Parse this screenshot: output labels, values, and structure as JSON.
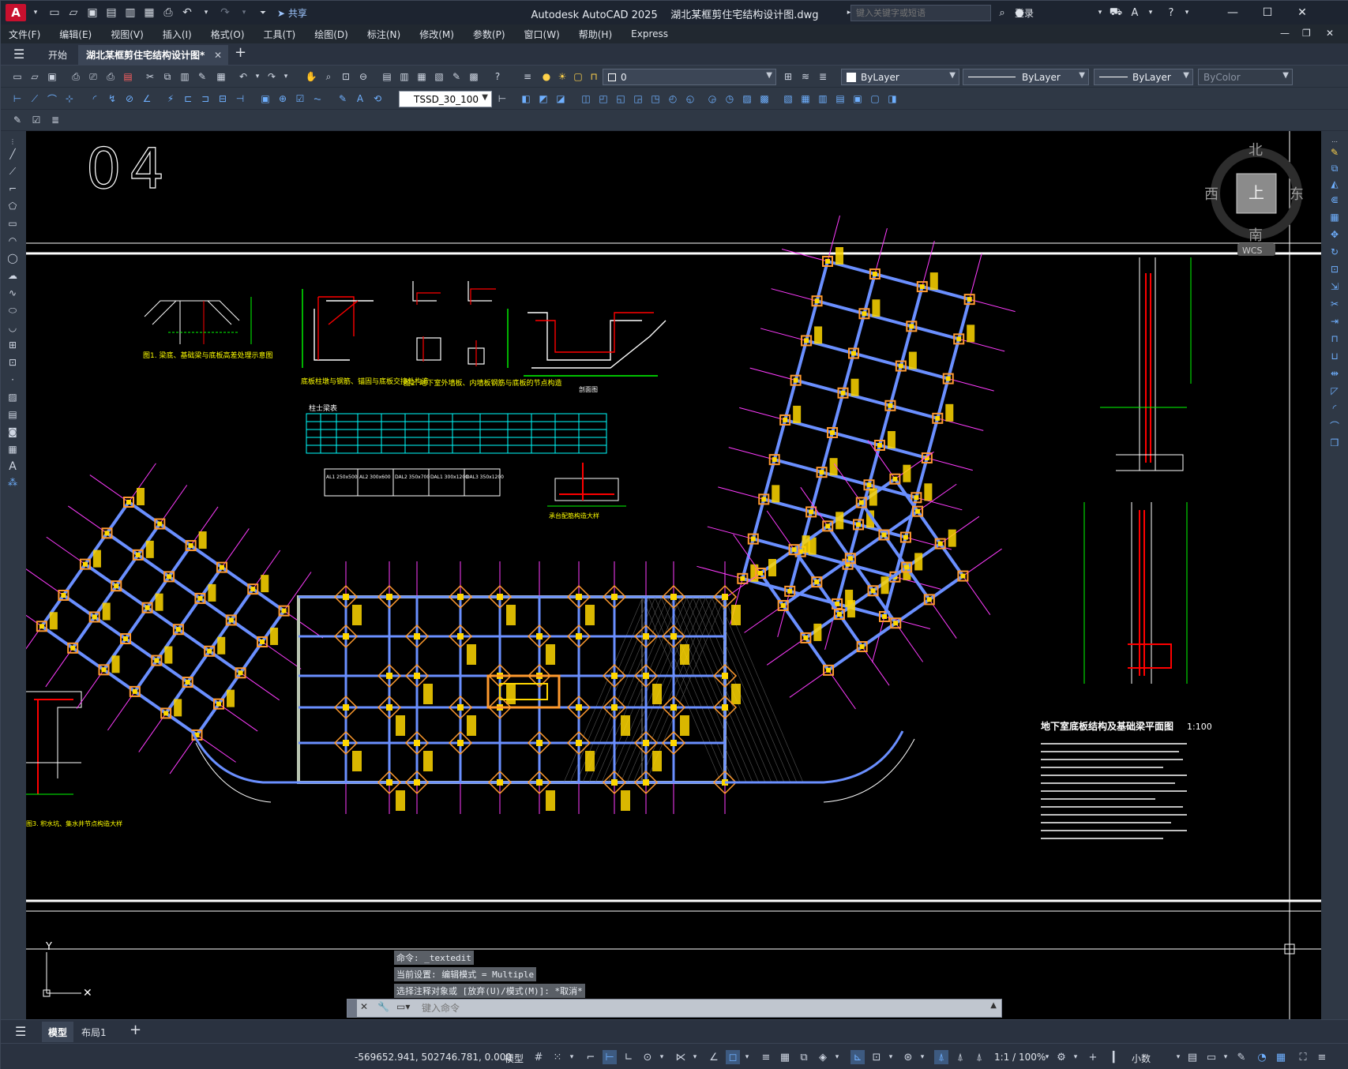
{
  "app": {
    "logo_letter": "A",
    "share_label": "共享",
    "title": "Autodesk AutoCAD 2025",
    "document_name": "湖北某框剪住宅结构设计图.dwg",
    "search_placeholder": "键入关键字或短语",
    "login_label": "登录"
  },
  "menu": [
    "文件(F)",
    "编辑(E)",
    "视图(V)",
    "插入(I)",
    "格式(O)",
    "工具(T)",
    "绘图(D)",
    "标注(N)",
    "修改(M)",
    "参数(P)",
    "窗口(W)",
    "帮助(H)",
    "Express"
  ],
  "tabs": {
    "start": "开始",
    "active_file": "湖北某框剪住宅结构设计图*"
  },
  "layer_toolbar": {
    "current_layer": "0",
    "color": "ByLayer",
    "linetype": "ByLayer",
    "lineweight": "ByLayer",
    "plot_style": "ByColor"
  },
  "style_toolbar": {
    "dim_style": "TSSD_30_100"
  },
  "drawing": {
    "sheet_number": "04",
    "viewcube": {
      "north": "北",
      "south": "南",
      "east": "东",
      "west": "西",
      "top": "上",
      "wcs": "WCS"
    },
    "plan_title": "地下室底板结构及基础梁平面图",
    "plan_scale": "1:100",
    "table_title": "柱士梁表",
    "detail_captions": [
      "图1. 梁底、基础梁与底板高差处理示意图",
      "底板柱墩与钢筋、锚固与底板交接处构造",
      "图2. 地下室外墙板、内墙板钢筋与底板的节点构造",
      "剖面图",
      "图3. 积水坑、集水井节点构造大样",
      "承台配筋构造大样"
    ],
    "beam_notes": [
      "AL1 250x500",
      "AL2 300x600",
      "DAL2 350x700",
      "DAL1 300x1200",
      "DAL3 350x1200"
    ]
  },
  "command": {
    "history": [
      "命令: _textedit",
      "当前设置: 编辑模式 = Multiple",
      "选择注释对象或 [放弃(U)/模式(M)]: *取消*"
    ],
    "placeholder": "键入命令"
  },
  "layout_tabs": {
    "model": "模型",
    "layout1": "布局1"
  },
  "status": {
    "coordinates": "-569652.941, 502746.781, 0.000",
    "space": "模型",
    "annotation_scale": "1:1 / 100%",
    "units": "小数"
  },
  "colors": {
    "canvas": "#000000",
    "chrome": "#2f3845",
    "title": "#1d2430",
    "accent": "#c8102e",
    "wall_blue": "#6a8fff",
    "gridline_magenta": "#ff3cff",
    "column_yellow": "#ffd700",
    "pad_orange": "#ff9a2e"
  }
}
